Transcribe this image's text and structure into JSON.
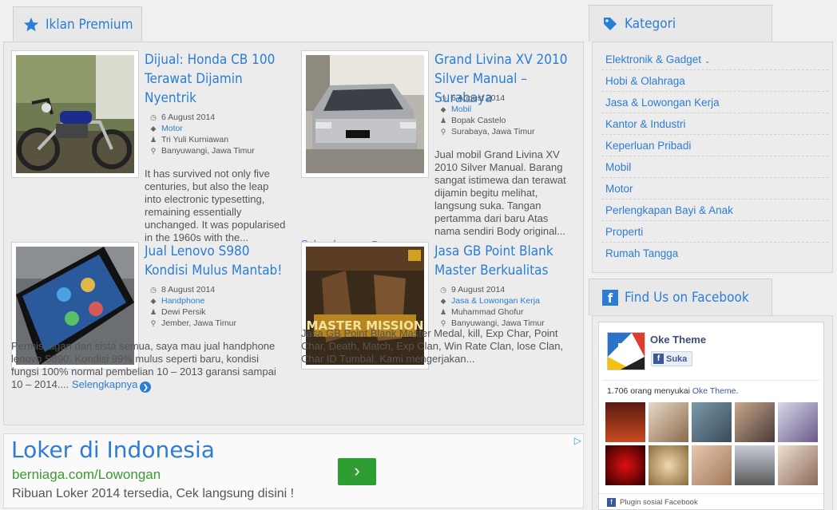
{
  "premium": {
    "heading": "Iklan Premium",
    "read_more": "Selengkapnya",
    "posts": [
      {
        "title": "Dijual: Honda CB 100 Terawat Dijamin Nyentrik",
        "date": "6 August 2014",
        "category": "Motor",
        "author": "Tri Yuli Kurniawan",
        "location": "Banyuwangi, Jawa Timur",
        "excerpt": "It has survived not only five centuries, but also the leap into electronic typesetting, remaining essentially unchanged. It was popularised in the 1960s with the..."
      },
      {
        "title": "Grand Livina XV 2010 Silver Manual – Surabaya",
        "date": "6 August 2014",
        "category": "Mobil",
        "author": "Bopak Castelo",
        "location": "Surabaya, Jawa Timur",
        "excerpt": "Jual mobil Grand Livina XV 2010 Silver Manual. Barang sangat istimewa dan terawat dijamin begitu melihat, langsung suka. Tangan pertamma dari baru Atas nama sendiri Body original..."
      },
      {
        "title": "Jual Lenovo S980 Kondisi Mulus Mantab!",
        "date": "8 August 2014",
        "category": "Handphone",
        "author": "Dewi Persik",
        "location": "Jember, Jawa Timur",
        "excerpt": "Permisi agan dan sista semua, saya mau jual handphone lenovo S890. Kondisi 99% mulus seperti baru, kondisi fungsi 100% normal pembelian 10 – 2013 garansi sampai 10 – 2014...."
      },
      {
        "title": "Jasa GB Point Blank Master Berkualitas",
        "date": "9 August 2014",
        "category": "Jasa & Lowongan Kerja",
        "author": "Muhammad Ghofur",
        "location": "Banyuwangi, Jawa Timur",
        "excerpt": "Jasa GB Point Blank Master Medal, kill, Exp Char, Point Char, Death, Match, Exp Clan, Win Rate Clan, lose Clan, Char ID Tumbal. Kami mengerjakan...",
        "image_text": "MASTER MISSION"
      }
    ]
  },
  "ad": {
    "headline": "Loker di Indonesia",
    "url": "berniaga.com/Lowongan",
    "description": "Ribuan Loker 2014 tersedia, Cek langsung disini !",
    "button": "›"
  },
  "kategori": {
    "heading": "Kategori",
    "items": [
      "Elektronik & Gadget",
      "Hobi & Olahraga",
      "Jasa & Lowongan Kerja",
      "Kantor & Industri",
      "Keperluan Pribadi",
      "Mobil",
      "Motor",
      "Perlengkapan Bayi & Anak",
      "Properti",
      "Rumah Tangga"
    ],
    "first_has_dropdown": true
  },
  "facebook": {
    "heading": "Find Us on Facebook",
    "page_name": "Oke Theme",
    "like_label": "Suka",
    "count_text": "1.706 orang menyukai ",
    "count_link": "Oke Theme",
    "count_end": ".",
    "plugin_label": "Plugin sosial Facebook"
  },
  "colors": {
    "accent": "#2c7dd6",
    "ad_url": "#3a9a2f",
    "ad_button": "#2e9e33",
    "facebook": "#3b5998"
  }
}
